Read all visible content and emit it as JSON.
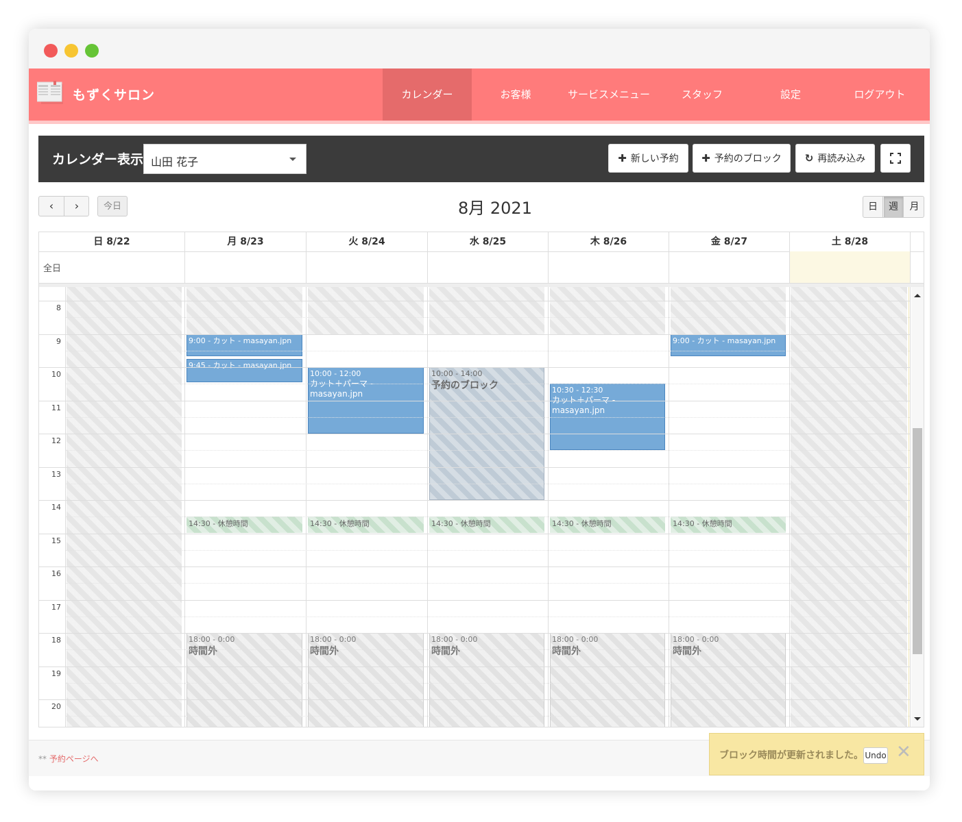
{
  "brand": "もずくサロン",
  "nav": {
    "items": [
      {
        "label": "カレンダー",
        "active": true
      },
      {
        "label": "お客様",
        "active": false
      },
      {
        "label": "サービスメニュー",
        "active": false
      },
      {
        "label": "スタッフ",
        "active": false
      },
      {
        "label": "設定",
        "active": false
      },
      {
        "label": "ログアウト",
        "active": false
      }
    ]
  },
  "toolbar": {
    "title": "カレンダー表示",
    "staff_selected": "山田 花子",
    "new_booking": "新しい予約",
    "block_booking": "予約のブロック",
    "reload": "再読み込み"
  },
  "calendar": {
    "today_label": "今日",
    "title": "8月 2021",
    "views": [
      {
        "label": "日",
        "active": false
      },
      {
        "label": "週",
        "active": true
      },
      {
        "label": "月",
        "active": false
      }
    ],
    "allday_label": "全日",
    "days": [
      "日 8/22",
      "月 8/23",
      "火 8/24",
      "水 8/25",
      "木 8/26",
      "金 8/27",
      "土 8/28"
    ],
    "hours": [
      "8",
      "9",
      "10",
      "11",
      "12",
      "13",
      "14",
      "15",
      "16",
      "17",
      "18",
      "19",
      "20"
    ],
    "events": [
      {
        "day": 1,
        "start": 9.0,
        "end": 9.67,
        "label": "9:00 - カット - masayan.jpn"
      },
      {
        "day": 1,
        "start": 9.75,
        "end": 10.45,
        "label": "9:45 - カット - masayan.jpn"
      },
      {
        "day": 2,
        "start": 10.0,
        "end": 12.0,
        "time": "10:00 - 12:00",
        "label": "カット＋パーマ - masayan.jpn"
      },
      {
        "day": 4,
        "start": 10.5,
        "end": 12.5,
        "time": "10:30 - 12:30",
        "label": "カット＋パーマ - masayan.jpn"
      },
      {
        "day": 5,
        "start": 9.0,
        "end": 9.67,
        "label": "9:00 - カット - masayan.jpn"
      }
    ],
    "block": {
      "day": 3,
      "start": 10.0,
      "end": 14.0,
      "time": "10:00 - 14:00",
      "label": "予約のブロック"
    },
    "breaks": [
      {
        "day": 1,
        "label": "14:30 - 休憩時間"
      },
      {
        "day": 2,
        "label": "14:30 - 休憩時間"
      },
      {
        "day": 3,
        "label": "14:30 - 休憩時間"
      },
      {
        "day": 4,
        "label": "14:30 - 休憩時間"
      },
      {
        "day": 5,
        "label": "14:30 - 休憩時間"
      }
    ],
    "off_hours": {
      "time": "18:00 - 0:00",
      "label": "時間外"
    }
  },
  "footer": {
    "link": "予約ページへ",
    "prefix": "**"
  },
  "toast": {
    "message": "ブロック時間が更新されました。",
    "undo": "Undo",
    "close": "✕"
  },
  "colors": {
    "nav": "#ff7b7b",
    "nav_active": "#e56b6b",
    "event": "#76aad8",
    "break": "#c8e1cd",
    "toast": "#f8e7a3"
  }
}
